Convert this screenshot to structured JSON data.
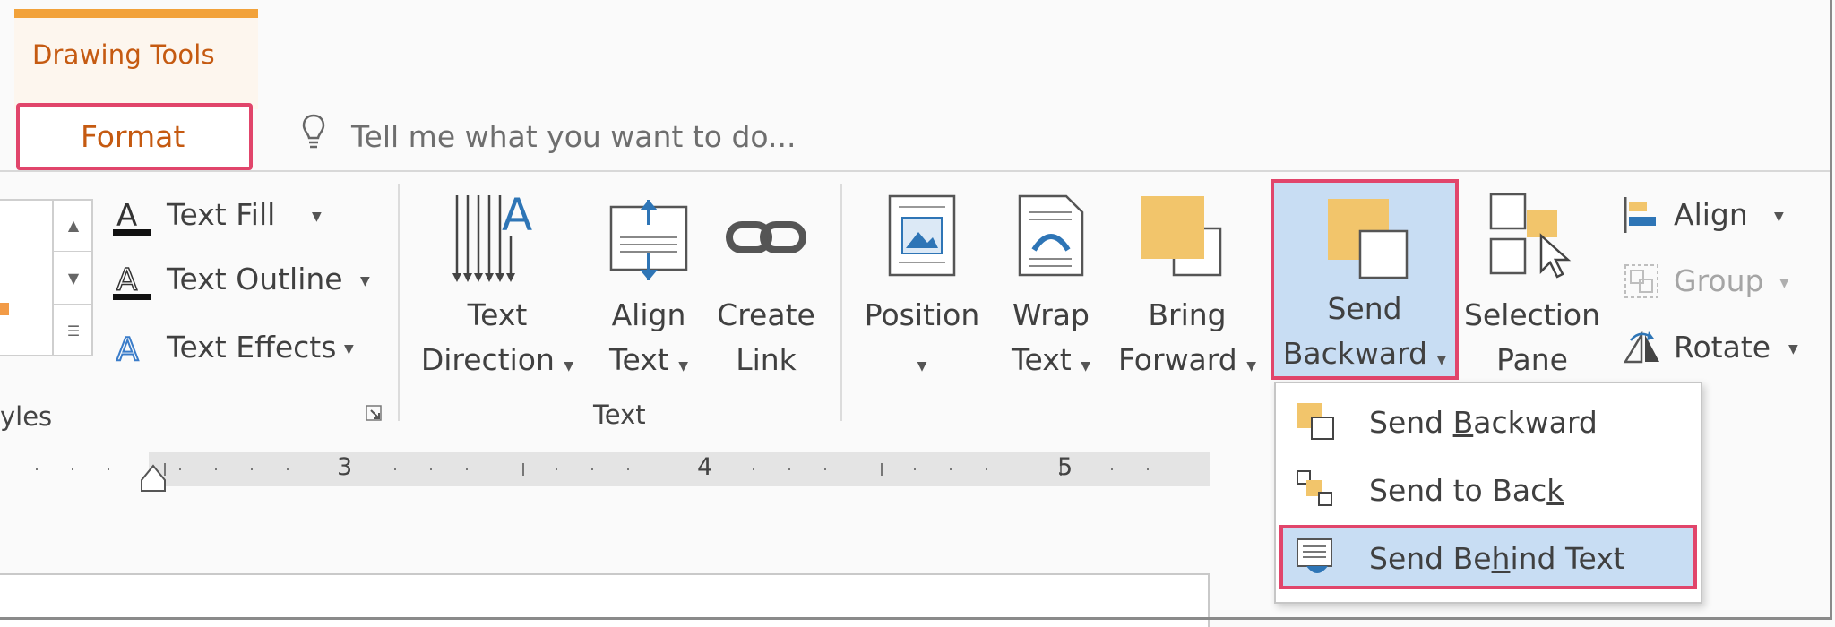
{
  "context_tab": {
    "title": "Drawing Tools",
    "active_tab": "Format"
  },
  "tell_me": {
    "placeholder": "Tell me what you want to do..."
  },
  "wordart": {
    "text_fill": "Text Fill",
    "text_outline": "Text Outline",
    "text_effects": "Text Effects",
    "group_label_partial": "yles"
  },
  "text_group": {
    "text_direction": [
      "Text",
      "Direction"
    ],
    "align_text": [
      "Align",
      "Text"
    ],
    "create_link": [
      "Create",
      "Link"
    ],
    "group_label": "Text"
  },
  "arrange_group": {
    "position": "Position",
    "wrap_text": [
      "Wrap",
      "Text"
    ],
    "bring_forward": [
      "Bring",
      "Forward"
    ],
    "send_backward": [
      "Send",
      "Backward"
    ],
    "selection_pane": [
      "Selection",
      "Pane"
    ],
    "align": "Align",
    "group": "Group",
    "rotate": "Rotate"
  },
  "ruler": {
    "marks": [
      "3",
      "4",
      "5"
    ]
  },
  "send_backward_menu": {
    "items": [
      {
        "pre": "Send ",
        "key": "B",
        "post": "ackward"
      },
      {
        "pre": "Send to Bac",
        "key": "k",
        "post": ""
      },
      {
        "pre": "Send Be",
        "key": "h",
        "post": "ind Text"
      }
    ],
    "highlighted_index": 2
  },
  "colors": {
    "accent_orange": "#c55a11",
    "context_bar": "#f2a23a",
    "highlight_outline": "#e1456b",
    "selected_fill": "#c8ddf3",
    "icon_tan": "#f2c56b"
  }
}
